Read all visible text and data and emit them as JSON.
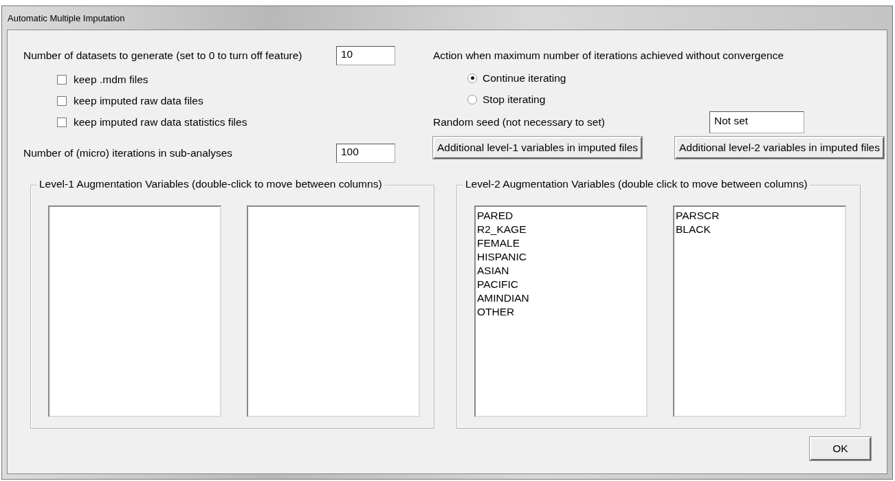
{
  "window": {
    "title": "Automatic Multiple Imputation"
  },
  "datasets": {
    "label": "Number of datasets to generate (set to 0 to turn off feature)",
    "value": "10"
  },
  "checkboxes": [
    {
      "label": "keep .mdm files",
      "checked": false
    },
    {
      "label": "keep imputed raw data files",
      "checked": false
    },
    {
      "label": "keep imputed raw data statistics files",
      "checked": false
    }
  ],
  "iterations": {
    "label": "Number of (micro) iterations in sub-analyses",
    "value": "100"
  },
  "convergence": {
    "label": "Action when maximum number of iterations achieved without convergence",
    "options": [
      {
        "label": "Continue iterating",
        "selected": true
      },
      {
        "label": "Stop iterating",
        "selected": false
      }
    ]
  },
  "seed": {
    "label": "Random seed (not necessary to set)",
    "value": "Not set"
  },
  "buttons": [
    "Additional level-1 variables in imputed files",
    "Additional level-2 variables in imputed files"
  ],
  "level1": {
    "title": "Level-1 Augmentation Variables (double-click to move between columns)"
  },
  "level2": {
    "title": "Level-2 Augmentation Variables (double click to move between columns)",
    "columns": [
      [
        "PARED",
        "R2_KAGE",
        "FEMALE",
        "HISPANIC",
        "ASIAN",
        "PACIFIC",
        "AMINDIAN",
        "OTHER"
      ],
      [
        "PARSCR",
        "BLACK"
      ]
    ]
  },
  "ok_button": "OK"
}
